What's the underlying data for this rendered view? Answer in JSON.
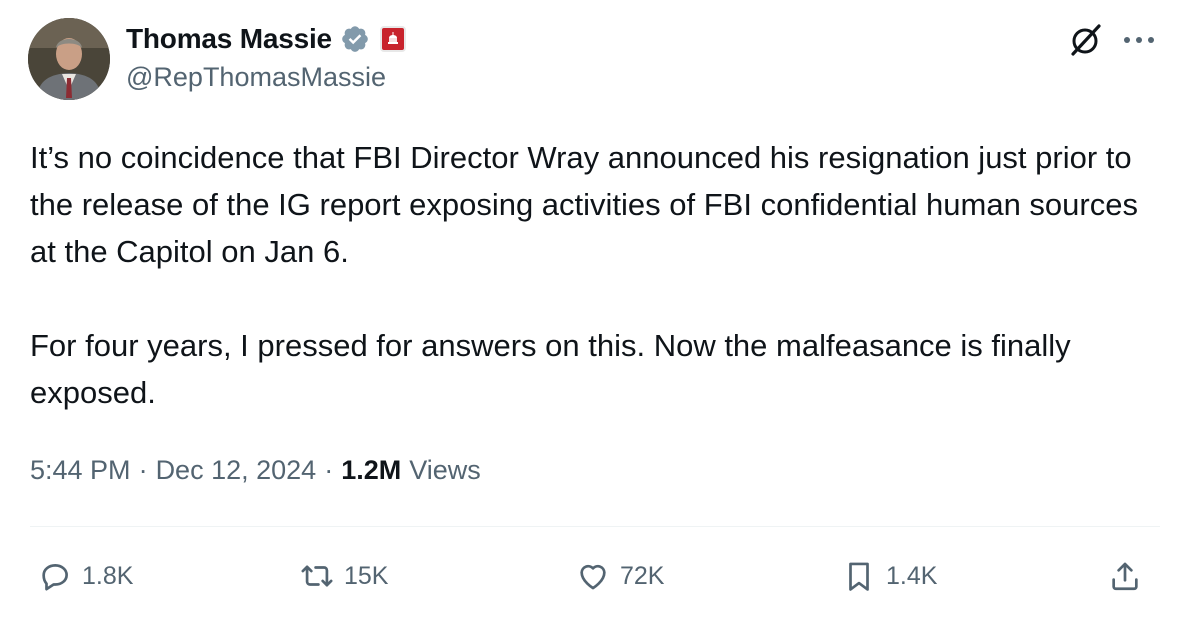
{
  "author": {
    "name": "Thomas Massie",
    "handle": "@RepThomasMassie",
    "verified_badge_color": "#829aab",
    "gov_badge_color": "#c8232c"
  },
  "tweet": {
    "paragraphs": [
      "It’s no coincidence that FBI Director Wray announced his resignation just prior to the release of the IG report exposing activities of FBI confidential human sources at the Capitol on Jan 6.",
      "For four years, I pressed for answers on this. Now the malfeasance is finally exposed."
    ]
  },
  "meta": {
    "time": "5:44 PM",
    "separator": "·",
    "date": "Dec 12, 2024",
    "views_count": "1.2M",
    "views_label": "Views"
  },
  "actions": {
    "replies": "1.8K",
    "reposts": "15K",
    "likes": "72K",
    "bookmarks": "1.4K"
  },
  "colors": {
    "text": "#0f1419",
    "secondary": "#536471",
    "divider": "#eff3f4"
  },
  "icons": [
    "grok-icon",
    "more-icon",
    "reply-icon",
    "repost-icon",
    "like-icon",
    "bookmark-icon",
    "share-icon",
    "verified-icon",
    "government-badge-icon"
  ]
}
